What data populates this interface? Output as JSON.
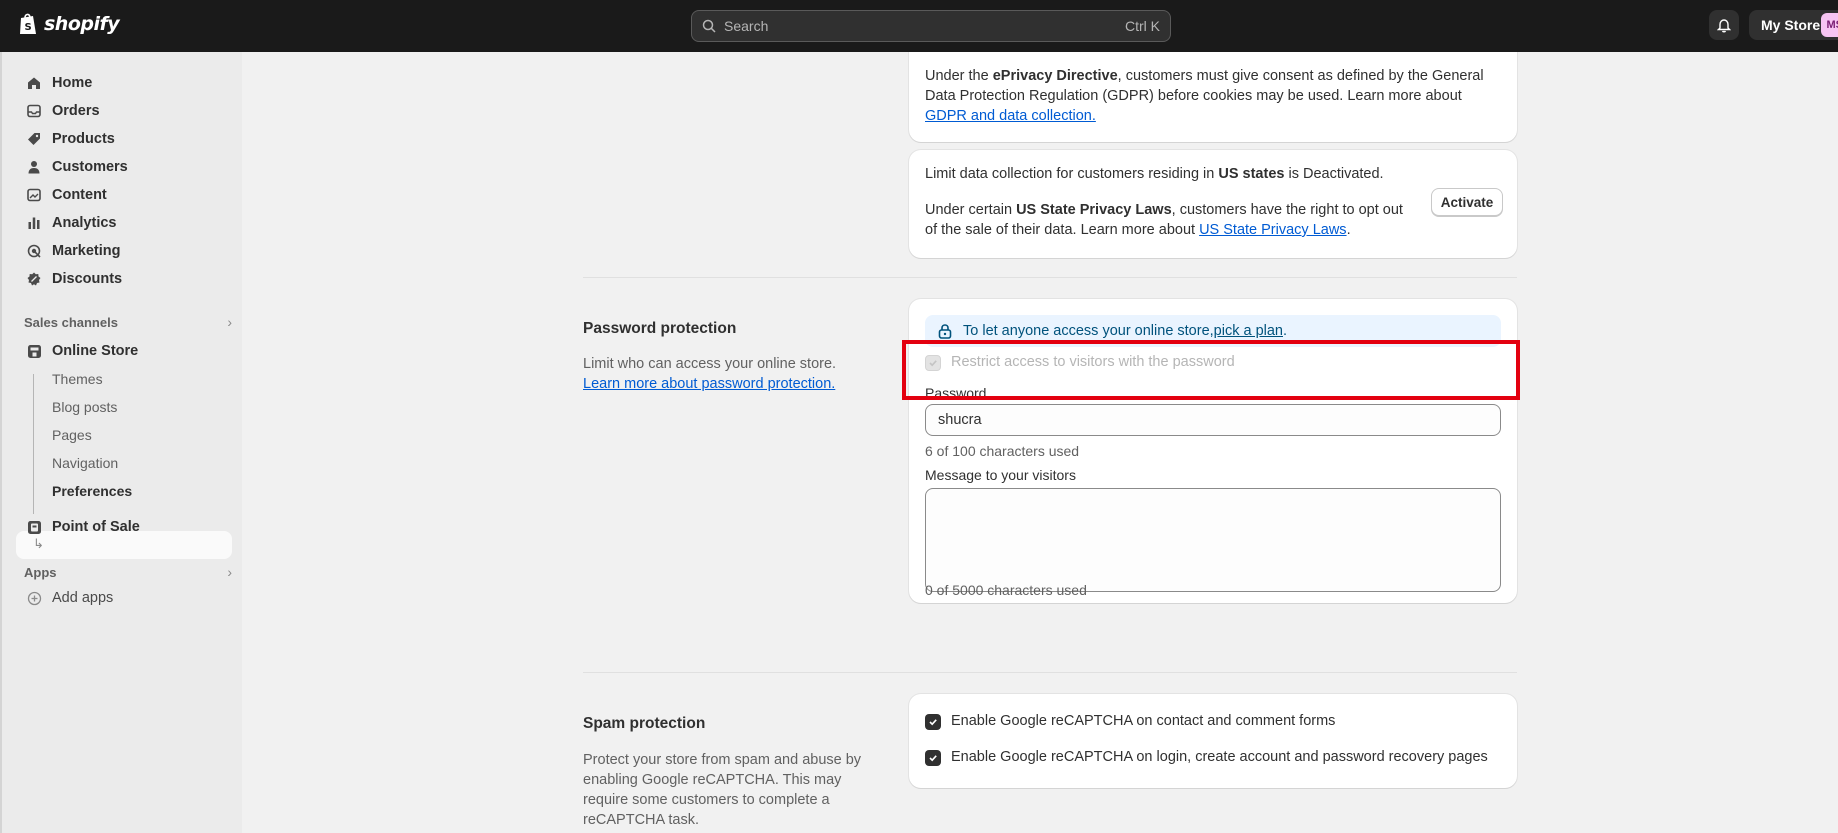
{
  "topbar": {
    "brand": "shopify",
    "search_placeholder": "Search",
    "search_shortcut": "Ctrl K",
    "store_name": "My Store",
    "avatar_initials": "MS",
    "avatar_color": "#f7c5f3"
  },
  "sidebar": {
    "items": [
      {
        "label": "Home",
        "icon": "home-icon"
      },
      {
        "label": "Orders",
        "icon": "inbox-icon"
      },
      {
        "label": "Products",
        "icon": "tag-icon"
      },
      {
        "label": "Customers",
        "icon": "person-icon"
      },
      {
        "label": "Content",
        "icon": "image-icon"
      },
      {
        "label": "Analytics",
        "icon": "bar-chart-icon"
      },
      {
        "label": "Marketing",
        "icon": "target-icon"
      },
      {
        "label": "Discounts",
        "icon": "discount-icon"
      }
    ],
    "sales_channels_label": "Sales channels",
    "online_store_label": "Online Store",
    "online_store_sub": [
      "Themes",
      "Blog posts",
      "Pages",
      "Navigation",
      "Preferences"
    ],
    "active_sub": "Preferences",
    "pos_label": "Point of Sale",
    "apps_label": "Apps",
    "add_apps_label": "Add apps"
  },
  "privacy": {
    "eprivacy_pre": "Under the ",
    "eprivacy_bold": "ePrivacy Directive",
    "eprivacy_mid": ", customers must give consent as defined by the General Data Protection Regulation (GDPR) before cookies may be used. Learn more about ",
    "eprivacy_link": "GDPR and data collection.",
    "us_pre": "Limit data collection for customers residing in ",
    "us_bold": "US states",
    "us_post": " is Deactivated.",
    "us_laws_pre": "Under certain ",
    "us_laws_bold": "US State Privacy Laws",
    "us_laws_mid": ", customers have the right to opt out of the sale of their data. Learn more about ",
    "us_laws_link": "US State Privacy Laws",
    "us_laws_post": ".",
    "activate_label": "Activate"
  },
  "password": {
    "title": "Password protection",
    "desc": "Limit who can access your online store. ",
    "desc_link": "Learn more about password protection.",
    "banner_text": "To let anyone access your online store, ",
    "banner_link": "pick a plan",
    "banner_post": ".",
    "restrict_label": "Restrict access to visitors with the password",
    "password_label": "Password",
    "password_value": "shucra",
    "password_count": "6 of 100 characters used",
    "message_label": "Message to your visitors",
    "message_value": "",
    "message_count": "0 of 5000 characters used"
  },
  "spam": {
    "title": "Spam protection",
    "desc": "Protect your store from spam and abuse by enabling Google reCAPTCHA. This may require some customers to complete a reCAPTCHA task.",
    "option1": "Enable Google reCAPTCHA on contact and comment forms",
    "option2": "Enable Google reCAPTCHA on login, create account and password recovery pages"
  },
  "colors": {
    "topbar": "#1a1a1a",
    "link": "#005bd3",
    "highlight": "#e3000f",
    "banner": "#eaf4ff"
  }
}
